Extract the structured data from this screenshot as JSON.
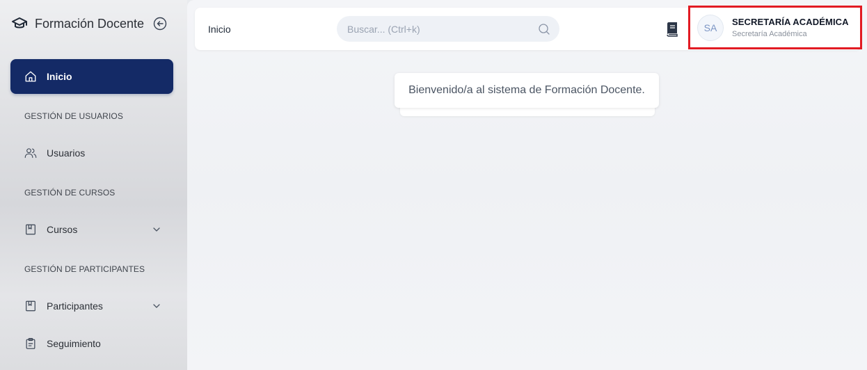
{
  "sidebar": {
    "brand": {
      "title": "Formación Docente",
      "icon": "graduation-cap-icon",
      "collapse_icon": "arrow-left-circle-icon"
    },
    "active_item": {
      "label": "Inicio",
      "icon": "home-icon"
    },
    "sections": [
      {
        "title": "GESTIÓN DE USUARIOS"
      },
      {
        "title": "GESTIÓN DE CURSOS"
      },
      {
        "title": "GESTIÓN DE PARTICIPANTES"
      }
    ],
    "items": [
      {
        "label": "Usuarios",
        "icon": "users-icon"
      },
      {
        "label": "Cursos",
        "icon": "bookmark-icon",
        "expandable": true
      },
      {
        "label": "Participantes",
        "icon": "bookmark-icon",
        "expandable": true
      },
      {
        "label": "Seguimiento",
        "icon": "clipboard-icon"
      }
    ]
  },
  "topbar": {
    "breadcrumb": "Inicio",
    "search": {
      "placeholder": "Buscar... (Ctrl+k)",
      "value": ""
    },
    "book_icon": "book-icon",
    "user": {
      "initials": "SA",
      "name": "SECRETARÍA ACADÉMICA",
      "role": "Secretaría Académica"
    }
  },
  "main": {
    "welcome": "Bienvenido/a al sistema de Formación Docente."
  },
  "colors": {
    "accent": "#142a66",
    "highlight_border": "#e21b23"
  }
}
